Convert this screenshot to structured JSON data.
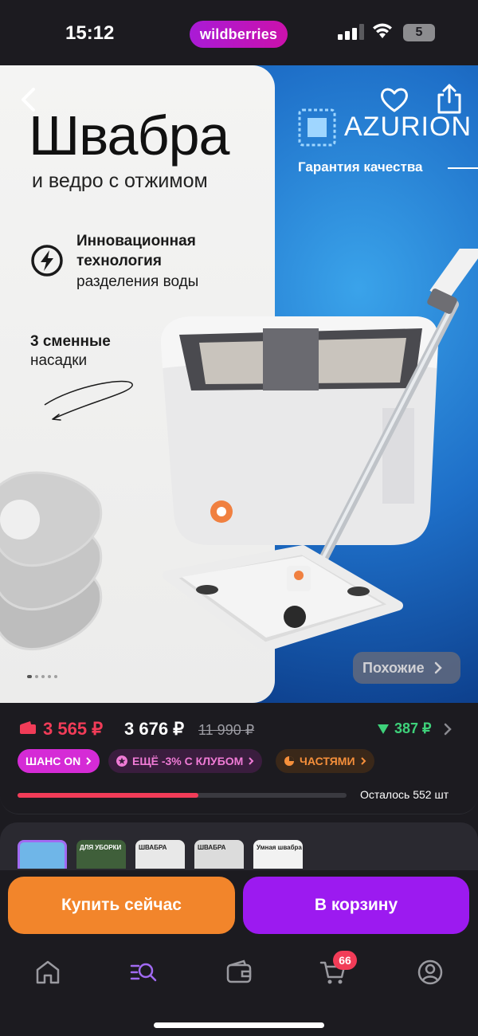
{
  "status_bar": {
    "time": "15:12",
    "app_pill": "wildberries",
    "battery": "5"
  },
  "hero": {
    "title": "Швабра",
    "subtitle": "и ведро с отжимом",
    "feature1": [
      "Инновационная",
      "технология",
      "разделения воды"
    ],
    "feature2": [
      "3 сменные",
      "насадки"
    ],
    "brand": "AZURION",
    "brand_tagline": "Гарантия качества",
    "similar_label": "Похожие",
    "image_count": 5,
    "active_image": 1
  },
  "price": {
    "wallet_price": "3 565 ₽",
    "price": "3 676 ₽",
    "old_price": "11 990 ₽",
    "cashback": "387 ₽",
    "colors": {
      "wallet": "#f23c58",
      "cashback": "#3ed17a"
    }
  },
  "chips": [
    {
      "label": "ШАНС ON"
    },
    {
      "label": "ЕЩЁ -3% С КЛУБОМ"
    },
    {
      "label": "ЧАСТЯМИ"
    }
  ],
  "stock": {
    "label": "Осталось 552 шт",
    "progress_fraction": 0.55
  },
  "variants": [
    {
      "text": "",
      "selected": true
    },
    {
      "text": "ДЛЯ УБОРКИ",
      "selected": false
    },
    {
      "text": "ШВАБРА",
      "selected": false
    },
    {
      "text": "ШВАБРА",
      "selected": false
    },
    {
      "text": "Умная швабра",
      "selected": false
    }
  ],
  "actions": {
    "buy_now": "Купить сейчас",
    "add_to_cart": "В корзину"
  },
  "nav": {
    "cart_badge": "66",
    "accent": "#a16af2"
  }
}
